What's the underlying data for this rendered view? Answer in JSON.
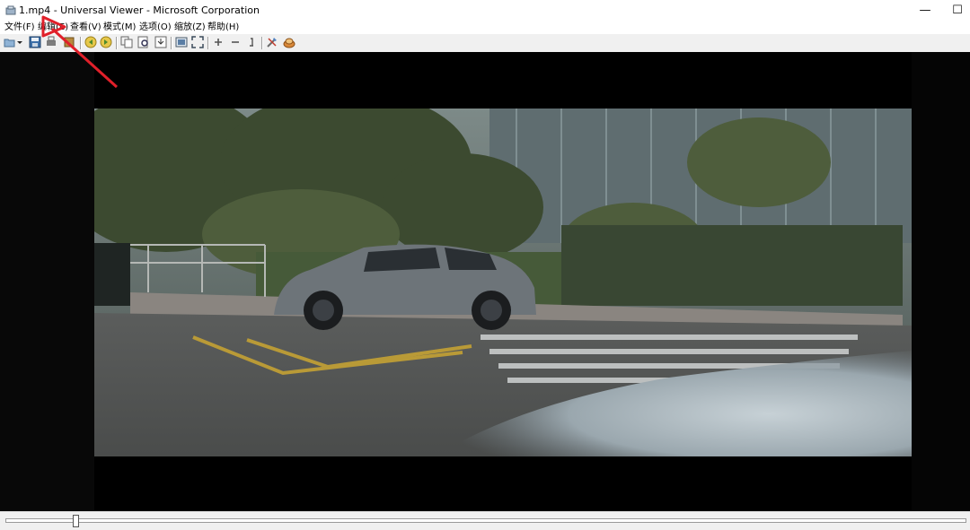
{
  "window": {
    "title": "1.mp4 - Universal Viewer - Microsoft Corporation",
    "minimize_glyph": "—",
    "maximize_glyph": "☐"
  },
  "menubar": {
    "items": [
      {
        "label": "文件(F)"
      },
      {
        "label": "编辑(E)"
      },
      {
        "label": "查看(V)"
      },
      {
        "label": "模式(M)"
      },
      {
        "label": "选项(O)"
      },
      {
        "label": "缩放(Z)"
      },
      {
        "label": "帮助(H)"
      }
    ]
  },
  "toolbar": {
    "icons": [
      "open-icon",
      "dropdown-arrow-icon",
      "save-icon",
      "print-icon",
      "properties-icon",
      "back-icon",
      "forward-icon",
      "copy-icon",
      "find-icon",
      "load-icon",
      "fit-window-icon",
      "fullscreen-icon",
      "zoom-in-icon",
      "zoom-out-icon",
      "zoom-original-icon",
      "settings-icon",
      "plugins-icon"
    ]
  },
  "player": {
    "position_fraction": 0.07
  },
  "colors": {
    "annotation_arrow": "#e0202a",
    "viewer_background": "#000000",
    "toolbar_background": "#f0f0f0"
  }
}
